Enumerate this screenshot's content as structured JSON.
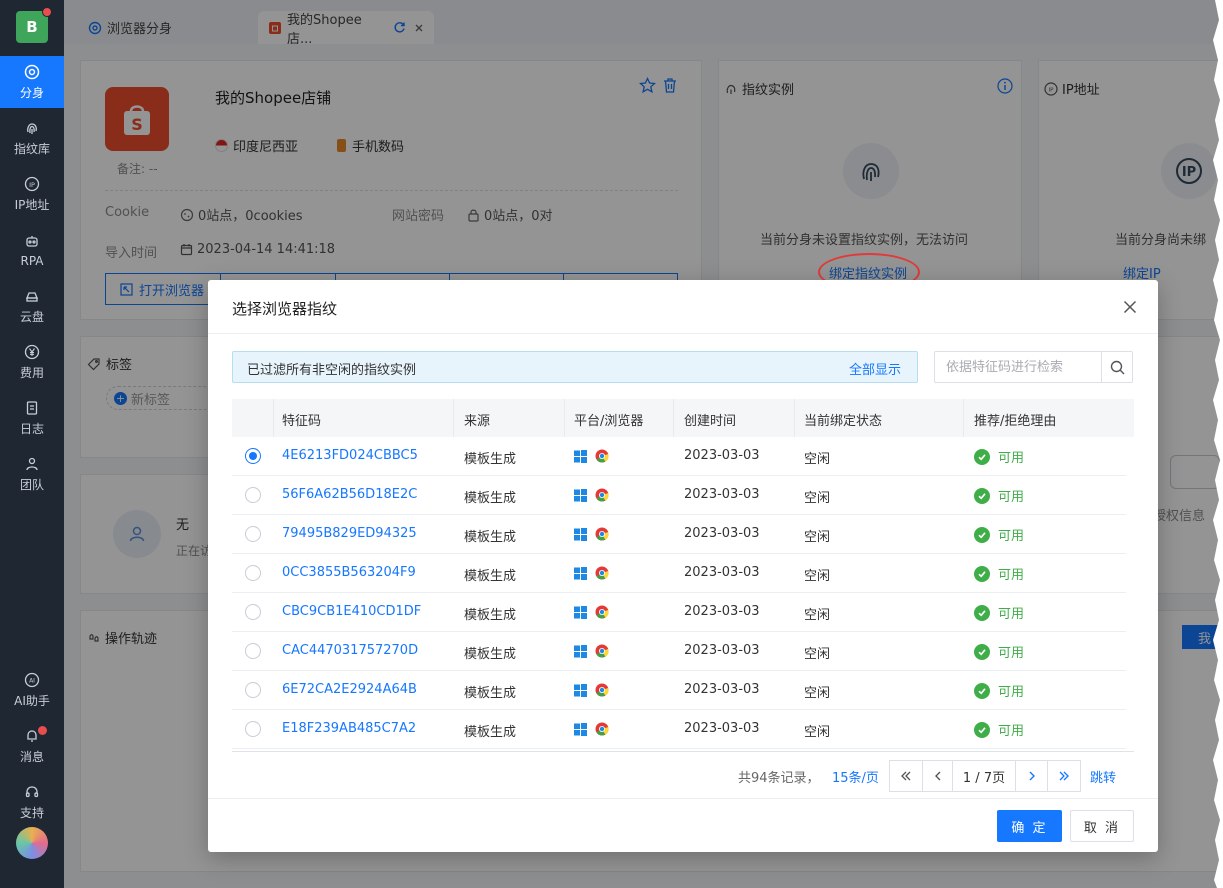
{
  "sidebar": {
    "logo_letter": "B",
    "items": [
      {
        "label": "分身",
        "icon": "browser-icon"
      },
      {
        "label": "指纹库",
        "icon": "fingerprint-icon"
      },
      {
        "label": "IP地址",
        "icon": "ip-icon"
      },
      {
        "label": "RPA",
        "icon": "robot-icon"
      },
      {
        "label": "云盘",
        "icon": "cloud-drive-icon"
      },
      {
        "label": "费用",
        "icon": "yen-icon"
      },
      {
        "label": "日志",
        "icon": "log-icon"
      },
      {
        "label": "团队",
        "icon": "team-icon"
      },
      {
        "label": "AI助手",
        "icon": "ai-icon"
      },
      {
        "label": "消息",
        "icon": "bell-icon"
      },
      {
        "label": "支持",
        "icon": "headset-icon"
      }
    ]
  },
  "tabs": [
    {
      "label": "浏览器分身"
    },
    {
      "label": "我的Shopee店..."
    }
  ],
  "profile": {
    "name": "我的Shopee店铺",
    "region": "印度尼西亚",
    "category": "手机数码",
    "note": "备注: --",
    "cookie_label": "Cookie",
    "cookie_value": "0站点，0cookies",
    "password_label": "网站密码",
    "password_value": "0站点，0对",
    "import_label": "导入时间",
    "import_value": "2023-04-14 14:41:18",
    "open_button": "打开浏览器",
    "tags_title": "标签",
    "new_tag": "新标签",
    "account_name": "无",
    "account_status": "正在访",
    "ops_title": "操作轨迹"
  },
  "fingerprint_card": {
    "title": "指纹实例",
    "message": "当前分身未设置指纹实例，无法访问",
    "bind_link": "绑定指纹实例"
  },
  "ip_card": {
    "title": "IP地址",
    "message": "当前分身尚未绑",
    "bind_link": "绑定IP"
  },
  "right_partial": {
    "text": "授权信息",
    "button": "我"
  },
  "modal": {
    "title": "选择浏览器指纹",
    "filter_text": "已过滤所有非空闲的指纹实例",
    "show_all": "全部显示",
    "search_placeholder": "依据特征码进行检索",
    "columns": [
      "特征码",
      "来源",
      "平台/浏览器",
      "创建时间",
      "当前绑定状态",
      "推荐/拒绝理由"
    ],
    "rows": [
      {
        "code": "4E6213FD024CBBC5",
        "source": "模板生成",
        "created": "2023-03-03",
        "state": "空闲",
        "reason": "可用",
        "selected": true
      },
      {
        "code": "56F6A62B56D18E2C",
        "source": "模板生成",
        "created": "2023-03-03",
        "state": "空闲",
        "reason": "可用",
        "selected": false
      },
      {
        "code": "79495B829ED94325",
        "source": "模板生成",
        "created": "2023-03-03",
        "state": "空闲",
        "reason": "可用",
        "selected": false
      },
      {
        "code": "0CC3855B563204F9",
        "source": "模板生成",
        "created": "2023-03-03",
        "state": "空闲",
        "reason": "可用",
        "selected": false
      },
      {
        "code": "CBC9CB1E410CD1DF",
        "source": "模板生成",
        "created": "2023-03-03",
        "state": "空闲",
        "reason": "可用",
        "selected": false
      },
      {
        "code": "CAC447031757270D",
        "source": "模板生成",
        "created": "2023-03-03",
        "state": "空闲",
        "reason": "可用",
        "selected": false
      },
      {
        "code": "6E72CA2E2924A64B",
        "source": "模板生成",
        "created": "2023-03-03",
        "state": "空闲",
        "reason": "可用",
        "selected": false
      },
      {
        "code": "E18F239AB485C7A2",
        "source": "模板生成",
        "created": "2023-03-03",
        "state": "空闲",
        "reason": "可用",
        "selected": false
      }
    ],
    "pager": {
      "total": "共94条记录，",
      "page_size": "15条/页",
      "current": "1 / 7页",
      "jump": "跳转"
    },
    "confirm": "确 定",
    "cancel": "取 消"
  },
  "colors": {
    "primary": "#1677ff",
    "sidebar": "#1f2733",
    "success": "#3fae48",
    "shopee": "#ee4d2d",
    "highlight": "#e03a3a"
  }
}
